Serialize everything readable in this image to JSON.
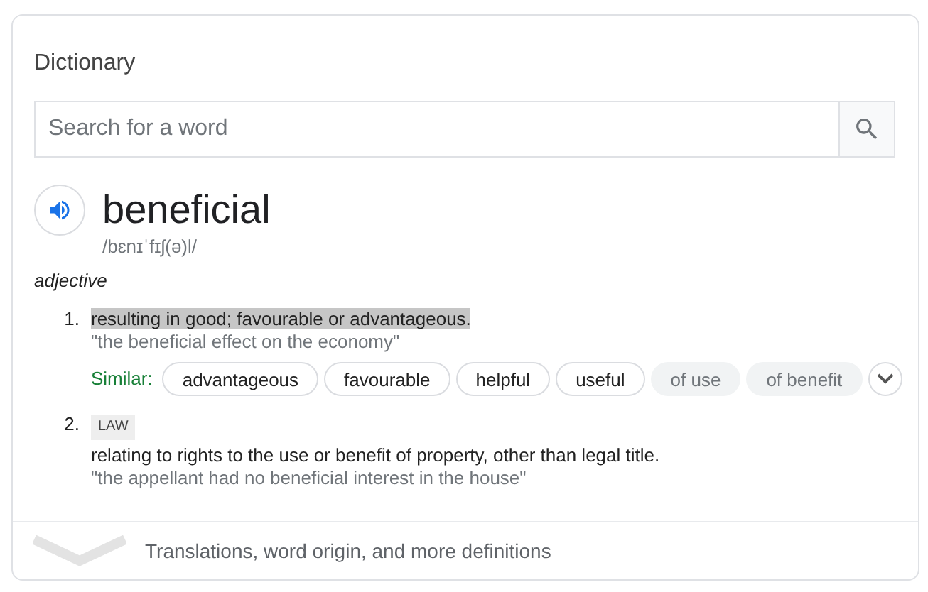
{
  "title": "Dictionary",
  "search": {
    "placeholder": "Search for a word"
  },
  "word": "beneficial",
  "phonetic": "/bɛnɪˈfɪʃ(ə)l/",
  "part_of_speech": "adjective",
  "definitions": [
    {
      "number": "1.",
      "text": "resulting in good; favourable or advantageous.",
      "highlighted": true,
      "example": "\"the beneficial effect on the economy\"",
      "similar_label": "Similar:",
      "similar": [
        {
          "text": "advantageous",
          "kind": "outlined"
        },
        {
          "text": "favourable",
          "kind": "outlined"
        },
        {
          "text": "helpful",
          "kind": "outlined"
        },
        {
          "text": "useful",
          "kind": "outlined"
        },
        {
          "text": "of use",
          "kind": "filled"
        },
        {
          "text": "of benefit",
          "kind": "filled"
        }
      ]
    },
    {
      "number": "2.",
      "label": "LAW",
      "text": "relating to rights to the use or benefit of property, other than legal title.",
      "highlighted": false,
      "example": "\"the appellant had no beneficial interest in the house\""
    }
  ],
  "footer": "Translations, word origin, and more definitions"
}
